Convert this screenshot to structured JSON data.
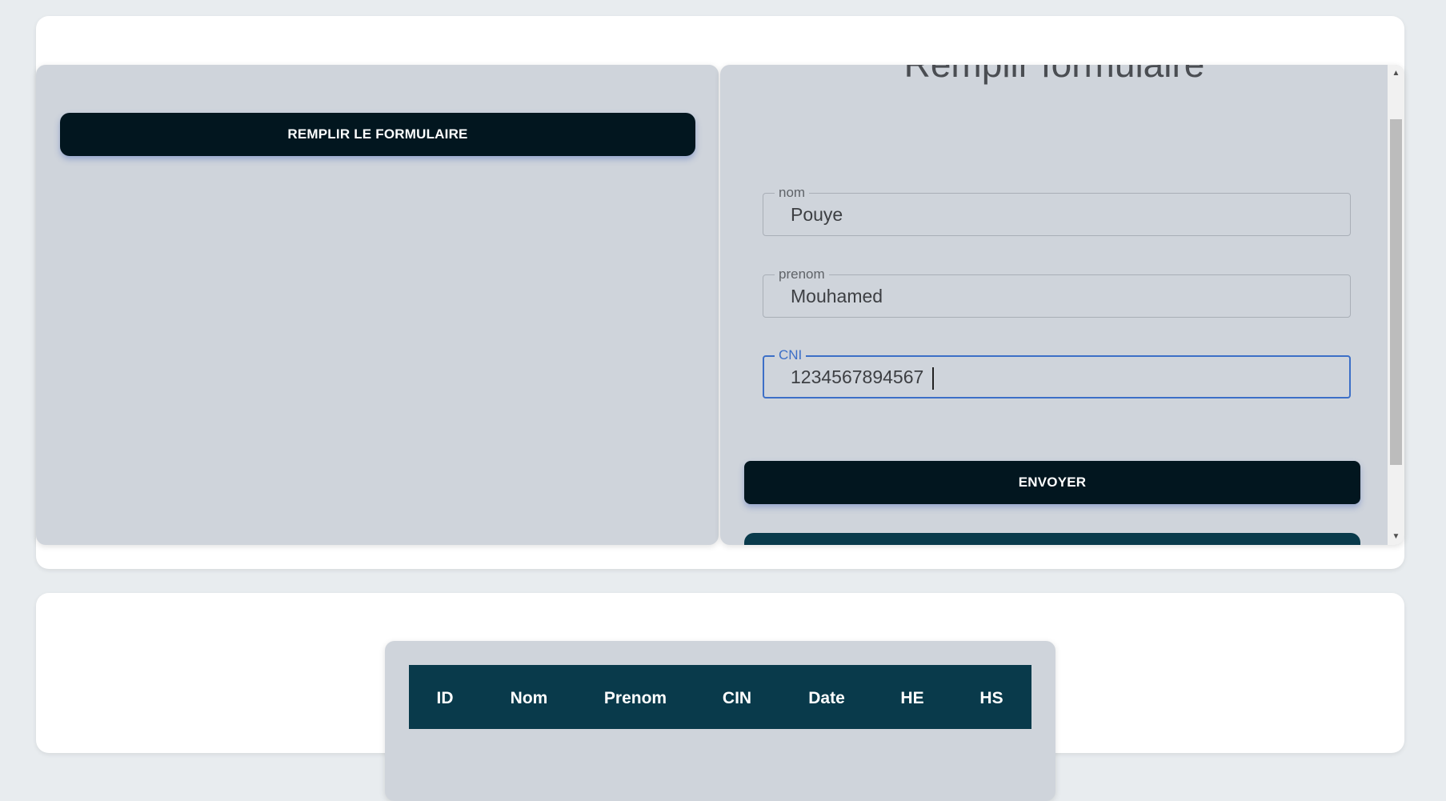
{
  "form_panel": {
    "fill_button_label": "REMPLIR LE FORMULAIRE",
    "title": "Remplir formulaire",
    "fields": [
      {
        "label": "nom",
        "value": "Pouye"
      },
      {
        "label": "prenom",
        "value": "Mouhamed"
      },
      {
        "label": "CNI",
        "value": "1234567894567"
      }
    ],
    "submit_label": "ENVOYER"
  },
  "table": {
    "headers": [
      "ID",
      "Nom",
      "Prenom",
      "CIN",
      "Date",
      "HE",
      "HS"
    ]
  },
  "colors": {
    "button_dark": "#02161f",
    "table_header": "#093a4b",
    "panel_bg": "#cfd4db",
    "focus_blue": "#3c6fc7"
  }
}
